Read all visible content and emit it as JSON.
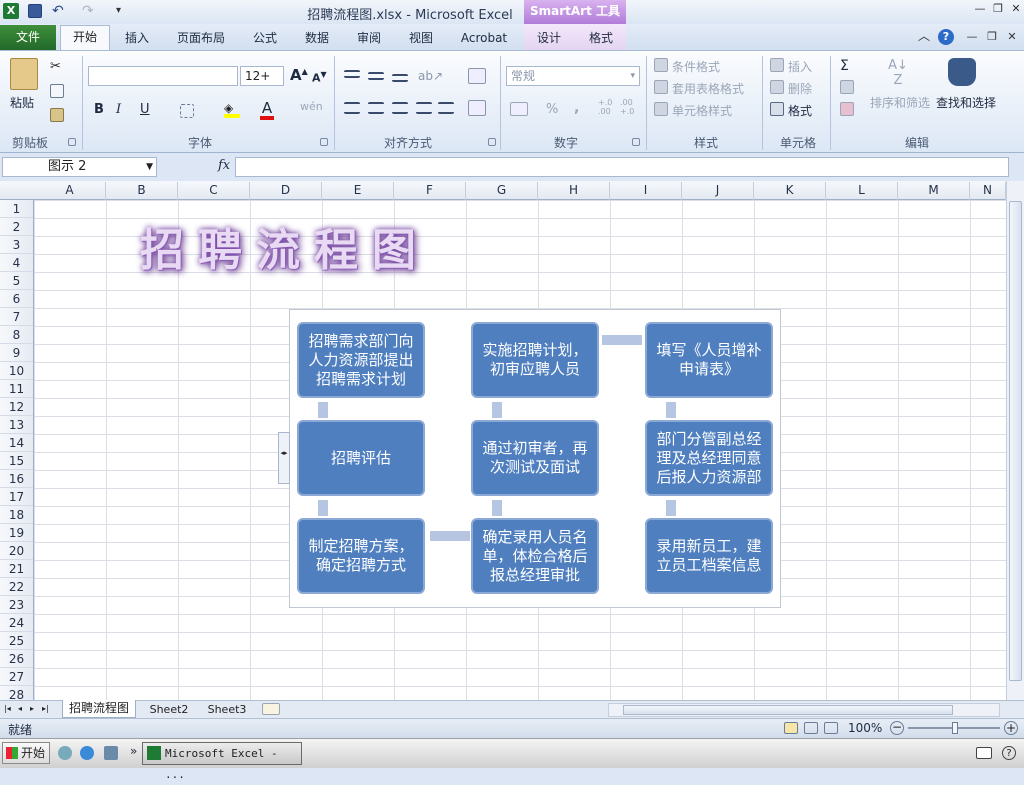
{
  "window": {
    "title": "招聘流程图.xlsx - Microsoft Excel",
    "context_label": "SmartArt 工具"
  },
  "tabs": {
    "file": "文件",
    "home": "开始",
    "insert": "插入",
    "layout": "页面布局",
    "formulas": "公式",
    "data": "数据",
    "review": "审阅",
    "view": "视图",
    "acrobat": "Acrobat",
    "design": "设计",
    "format": "格式"
  },
  "ribbon": {
    "paste": "粘贴",
    "clipboard": "剪贴板",
    "font_group": "字体",
    "font_size": "12+",
    "bold": "B",
    "italic": "I",
    "underline": "U",
    "font_color_glyph": "A",
    "wen": "wén",
    "align_group": "对齐方式",
    "number_group": "数字",
    "number_format": "常规",
    "percent": "%",
    "comma": ",",
    "dec_inc": "+.0\n.00",
    "dec_dec": ".00\n+.0",
    "styles_group": "样式",
    "cond_format": "条件格式",
    "table_format": "套用表格格式",
    "cell_styles": "单元格样式",
    "cells_group": "单元格",
    "insert": "插入",
    "delete": "删除",
    "format": "格式",
    "edit_group": "编辑",
    "sort_filter": "排序和筛选",
    "find_select": "查找和选择",
    "sigma": "Σ"
  },
  "formula_bar": {
    "name_box": "图示 2",
    "fx": "fx",
    "value": ""
  },
  "columns": [
    "A",
    "B",
    "C",
    "D",
    "E",
    "F",
    "G",
    "H",
    "I",
    "J",
    "K",
    "L",
    "M",
    "N"
  ],
  "rows": [
    "1",
    "2",
    "3",
    "4",
    "5",
    "6",
    "7",
    "8",
    "9",
    "10",
    "11",
    "12",
    "13",
    "14",
    "15",
    "16",
    "17",
    "18",
    "19",
    "20",
    "21",
    "22",
    "23",
    "24",
    "25",
    "26",
    "27",
    "28"
  ],
  "wordart": "招聘流程图",
  "smartart": {
    "nodes": [
      "招聘需求部门向人力资源部提出招聘需求计划",
      "实施招聘计划，初审应聘人员",
      "填写《人员增补申请表》",
      "招聘评估",
      "通过初审者，再次测试及面试",
      "部门分管副总经理及总经理同意后报人力资源部",
      "制定招聘方案，确定招聘方式",
      "确定录用人员名单，体检合格后报总经理审批",
      "录用新员工，建立员工档案信息"
    ]
  },
  "sheets": [
    "招聘流程图",
    "Sheet2",
    "Sheet3"
  ],
  "status": {
    "ready": "就绪",
    "zoom": "100%"
  },
  "taskbar": {
    "start": "开始",
    "app": "Microsoft Excel - ...",
    "chevron": "»"
  }
}
